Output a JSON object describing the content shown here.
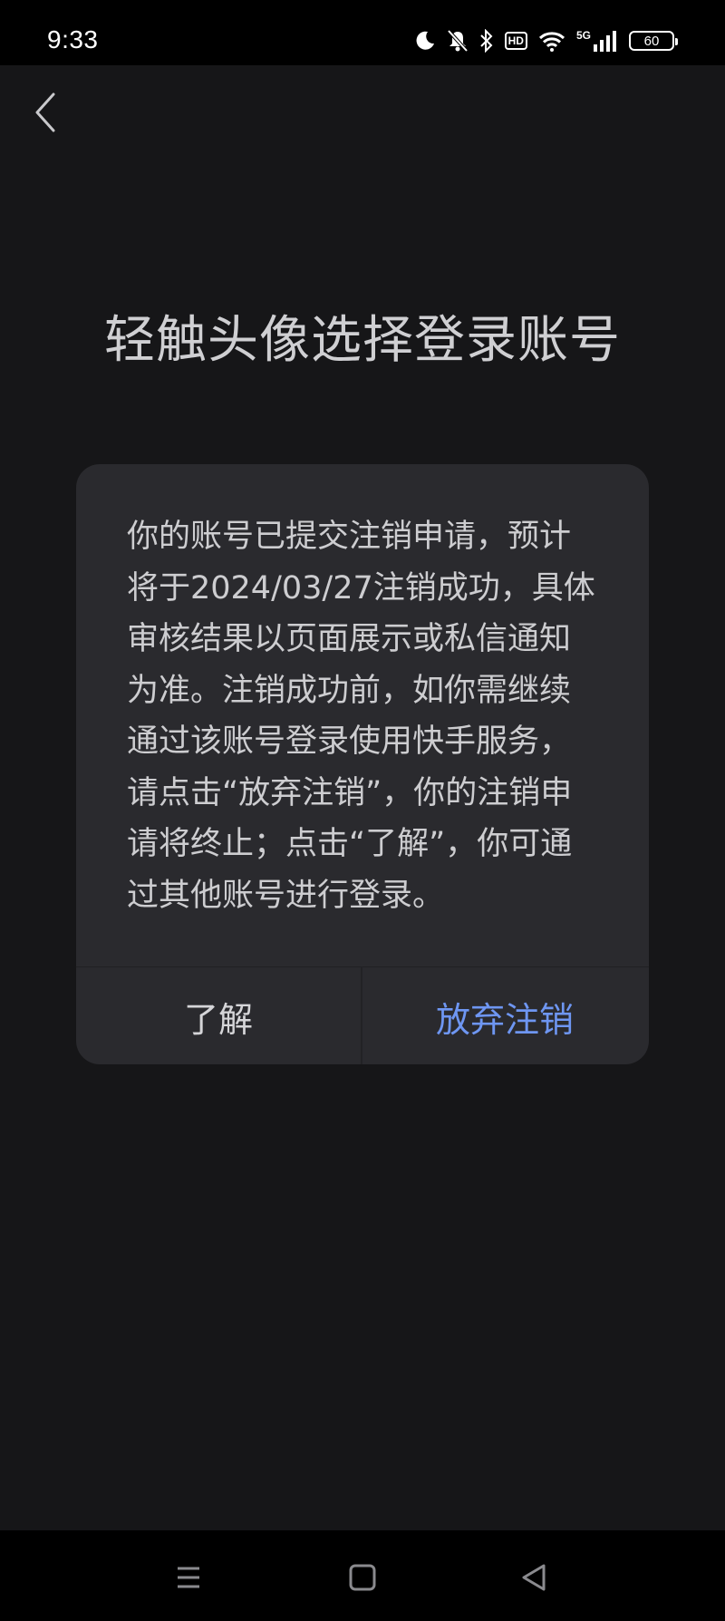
{
  "status_bar": {
    "time": "9:33",
    "network": "5G",
    "hd_label": "HD",
    "battery": "60"
  },
  "page": {
    "title": "轻触头像选择登录账号"
  },
  "dialog": {
    "message_lines": [
      "你的账号已提交注销申请，预计",
      "将于2024/03/27注销成功，具体",
      "审核结果以页面展示或私信通知",
      "为准。注销成功前，如你需继续",
      "通过该账号登录使用快手服务，",
      "请点击“放弃注销”，你的注销申",
      "请将终止；点击“了解”，你可通",
      "过其他账号进行登录。"
    ],
    "confirm_label": "了解",
    "abandon_label": "放弃注销"
  },
  "colors": {
    "background": "#161618",
    "dialog_bg": "#2a2a2e",
    "accent": "#6e96f2"
  }
}
